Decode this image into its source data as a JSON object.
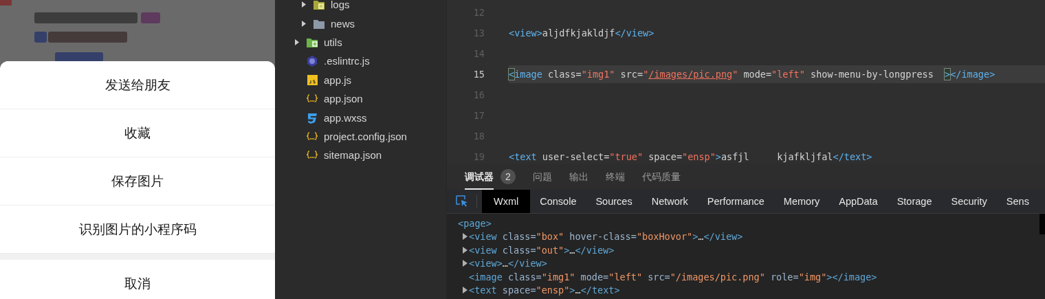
{
  "preview": {
    "action_sheet": {
      "items": [
        {
          "label": "发送给朋友",
          "kind": "action"
        },
        {
          "label": "收藏",
          "kind": "action"
        },
        {
          "label": "保存图片",
          "kind": "action"
        },
        {
          "label": "识别图片的小程序码",
          "kind": "action"
        },
        {
          "label": "取消",
          "kind": "cancel"
        }
      ]
    }
  },
  "file_tree": {
    "items": [
      {
        "children": [
          {
            "name": "logs",
            "kind": "folder-doc",
            "expanded": false
          },
          {
            "name": "news",
            "kind": "folder",
            "expanded": false
          }
        ]
      },
      {
        "name": "utils",
        "kind": "folder-plus",
        "expanded": false
      },
      {
        "name": ".eslintrc.js",
        "kind": "eslint"
      },
      {
        "name": "app.js",
        "kind": "js"
      },
      {
        "name": "app.json",
        "kind": "json"
      },
      {
        "name": "app.wxss",
        "kind": "css"
      },
      {
        "name": "project.config.json",
        "kind": "json"
      },
      {
        "name": "sitemap.json",
        "kind": "json"
      }
    ]
  },
  "editor": {
    "lines": [
      {
        "number": "12",
        "current": false
      },
      {
        "number": "13",
        "current": false,
        "tokens": [
          {
            "text": "<view>",
            "kind": "tag"
          },
          {
            "text": "aljdfkjakldjf",
            "kind": "text"
          },
          {
            "text": "</view>",
            "kind": "tag"
          }
        ]
      },
      {
        "number": "14",
        "current": false
      },
      {
        "number": "15",
        "current": true,
        "tokens": [
          {
            "text": "<",
            "kind": "match"
          },
          {
            "text": "image ",
            "kind": "tag"
          },
          {
            "text": "class=",
            "kind": "attr"
          },
          {
            "text": "\"img1\"",
            "kind": "string"
          },
          {
            "text": " src=",
            "kind": "attr"
          },
          {
            "text": "\"",
            "kind": "string"
          },
          {
            "text": "/images/pic.png",
            "kind": "link"
          },
          {
            "text": "\"",
            "kind": "string"
          },
          {
            "text": " mode=",
            "kind": "attr"
          },
          {
            "text": "\"left\"",
            "kind": "string"
          },
          {
            "text": " show-menu-by-longpress  ",
            "kind": "attr"
          },
          {
            "text": ">",
            "kind": "match"
          },
          {
            "text": "</image>",
            "kind": "tag"
          }
        ]
      },
      {
        "number": "16",
        "current": false
      },
      {
        "number": "17",
        "current": false
      },
      {
        "number": "18",
        "current": false
      },
      {
        "number": "19",
        "current": false,
        "tokens": [
          {
            "text": "<text ",
            "kind": "tag"
          },
          {
            "text": "user-select=",
            "kind": "attr"
          },
          {
            "text": "\"true\"",
            "kind": "string"
          },
          {
            "text": " space=",
            "kind": "attr"
          },
          {
            "text": "\"ensp\"",
            "kind": "string"
          },
          {
            "text": ">",
            "kind": "tag"
          },
          {
            "text": "asfjl     kjafkljfal",
            "kind": "text"
          },
          {
            "text": "</text>",
            "kind": "tag"
          }
        ]
      }
    ]
  },
  "panel_tabs": [
    {
      "label": "调试器",
      "selected": true,
      "badge": "2"
    },
    {
      "label": "问题",
      "selected": false
    },
    {
      "label": "输出",
      "selected": false
    },
    {
      "label": "终端",
      "selected": false
    },
    {
      "label": "代码质量",
      "selected": false
    }
  ],
  "devtools_tabs": [
    {
      "label": "Wxml",
      "selected": true
    },
    {
      "label": "Console",
      "selected": false
    },
    {
      "label": "Sources",
      "selected": false
    },
    {
      "label": "Network",
      "selected": false
    },
    {
      "label": "Performance",
      "selected": false
    },
    {
      "label": "Memory",
      "selected": false
    },
    {
      "label": "AppData",
      "selected": false
    },
    {
      "label": "Storage",
      "selected": false
    },
    {
      "label": "Security",
      "selected": false
    },
    {
      "label": "Sens",
      "selected": false
    }
  ],
  "wxml_tree": [
    {
      "toggle": false,
      "tokens": [
        {
          "text": "<page>",
          "kind": "tag"
        }
      ],
      "children": [
        {
          "toggle": true,
          "tokens": [
            {
              "text": "<view ",
              "kind": "tag"
            },
            {
              "text": "class=",
              "kind": "attr"
            },
            {
              "text": "\"box\"",
              "kind": "string"
            },
            {
              "text": " hover-class=",
              "kind": "attr"
            },
            {
              "text": "\"boxHovor\"",
              "kind": "string"
            },
            {
              "text": ">",
              "kind": "tag"
            },
            {
              "text": "…",
              "kind": "text"
            },
            {
              "text": "</view>",
              "kind": "tag"
            }
          ]
        },
        {
          "toggle": true,
          "tokens": [
            {
              "text": "<view ",
              "kind": "tag"
            },
            {
              "text": "class=",
              "kind": "attr"
            },
            {
              "text": "\"out\"",
              "kind": "string"
            },
            {
              "text": ">",
              "kind": "tag"
            },
            {
              "text": "…",
              "kind": "text"
            },
            {
              "text": "</view>",
              "kind": "tag"
            }
          ]
        },
        {
          "toggle": true,
          "tokens": [
            {
              "text": "<view>",
              "kind": "tag"
            },
            {
              "text": "…",
              "kind": "text"
            },
            {
              "text": "</view>",
              "kind": "tag"
            }
          ]
        },
        {
          "toggle": false,
          "tokens": [
            {
              "text": "<image ",
              "kind": "tag"
            },
            {
              "text": "class=",
              "kind": "attr"
            },
            {
              "text": "\"img1\"",
              "kind": "string"
            },
            {
              "text": " mode=",
              "kind": "attr"
            },
            {
              "text": "\"left\"",
              "kind": "string"
            },
            {
              "text": " src=",
              "kind": "attr"
            },
            {
              "text": "\"/images/pic.png\"",
              "kind": "string"
            },
            {
              "text": " role=",
              "kind": "attr"
            },
            {
              "text": "\"img\"",
              "kind": "string"
            },
            {
              "text": "></image>",
              "kind": "tag"
            }
          ]
        },
        {
          "toggle": true,
          "tokens": [
            {
              "text": "<text ",
              "kind": "tag"
            },
            {
              "text": "space=",
              "kind": "attr"
            },
            {
              "text": "\"ensp\"",
              "kind": "string"
            },
            {
              "text": ">",
              "kind": "tag"
            },
            {
              "text": "…",
              "kind": "text"
            },
            {
              "text": "</text>",
              "kind": "tag"
            }
          ]
        }
      ]
    }
  ]
}
